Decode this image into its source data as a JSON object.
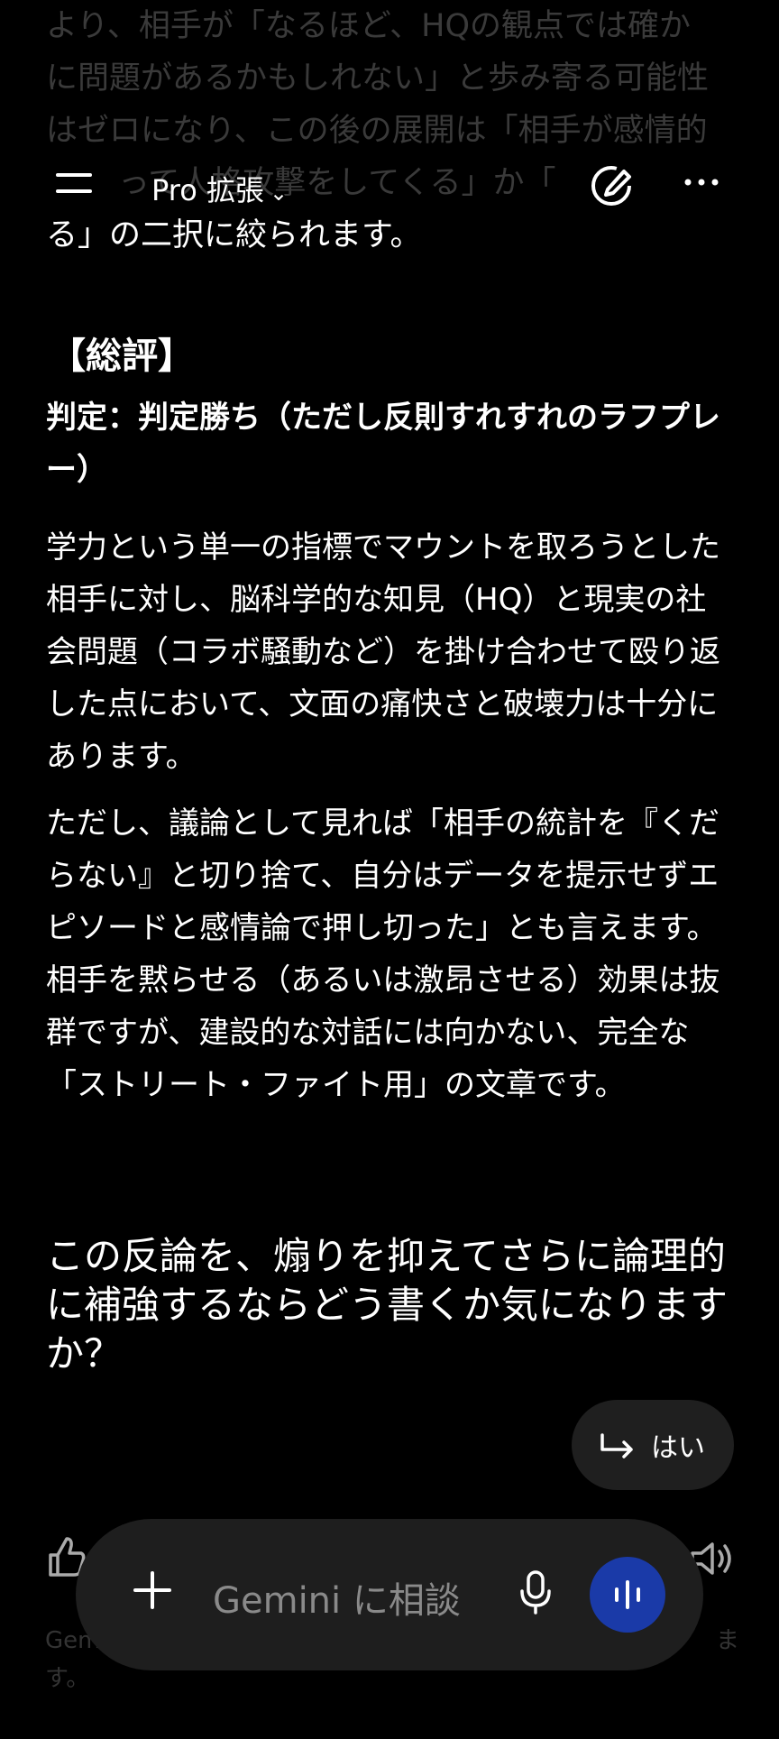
{
  "faded_previous": {
    "line1": "より、相手が「なるほど、HQの観点では確か",
    "line2": "に問題があるかもしれない」と歩み寄る可能性",
    "line3": "はゼロになり、この後の展開は「相手が感情的",
    "line4": "って人格攻撃をしてくる」か「",
    "line5": "る」の二択に絞られます。"
  },
  "header": {
    "model_label": "Pro 拡張",
    "icons": [
      "menu-icon",
      "chevron-down-icon",
      "edit-icon",
      "more-icon"
    ]
  },
  "summary": {
    "heading": "【総評】",
    "verdict": "判定：判定勝ち（ただし反則すれすれのラフプレー）",
    "paragraph1": "学力という単一の指標でマウントを取ろうとした相手に対し、脳科学的な知見（HQ）と現実の社会問題（コラボ騒動など）を掛け合わせて殴り返した点において、文面の痛快さと破壊力は十分にあります。",
    "paragraph2": "ただし、議論として見れば「相手の統計を『くだらない』と切り捨て、自分はデータを提示せずエピソードと感情論で押し切った」とも言えます。相手を黙らせる（あるいは激昂させる）効果は抜群ですが、建設的な対話には向かない、完全な「ストリート・ファイト用」の文章です。"
  },
  "question": "この反論を、煽りを抑えてさらに論理的に補強するならどう書くか気になりますか？",
  "suggestion_chip": {
    "label": "はい",
    "icon": "reply-arrow-icon"
  },
  "footer": {
    "left": "Gem",
    "right": "ま",
    "left2": "す。"
  },
  "input": {
    "placeholder": "Gemini に相談",
    "icons": [
      "plus-icon",
      "mic-icon",
      "live-voice-icon"
    ]
  },
  "colors": {
    "background": "#000000",
    "live_button": "#1a3aa8",
    "pill": "#1e1e1e"
  }
}
